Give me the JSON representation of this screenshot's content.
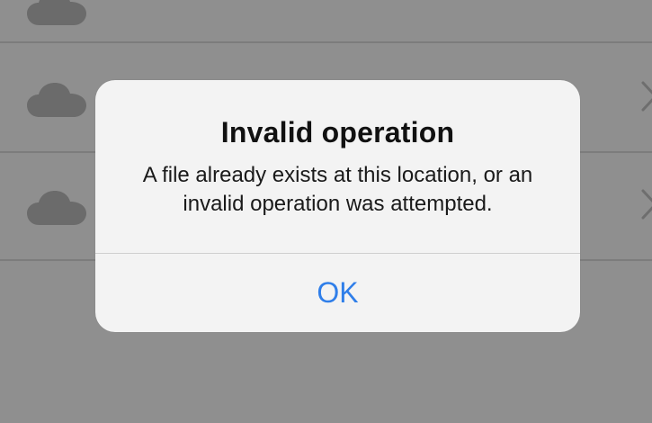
{
  "background_list": {
    "rows": [
      {
        "icon": "cloud-icon",
        "has_chevron": false
      },
      {
        "icon": "cloud-icon",
        "has_chevron": true
      },
      {
        "icon": "cloud-icon",
        "has_chevron": true
      }
    ]
  },
  "alert": {
    "title": "Invalid operation",
    "message": "A file already exists at this location, or an invalid operation was attempted.",
    "ok_label": "OK"
  },
  "colors": {
    "accent": "#2f7ee9",
    "overlay_background": "#8f8f8f",
    "alert_background": "#f3f3f3"
  }
}
